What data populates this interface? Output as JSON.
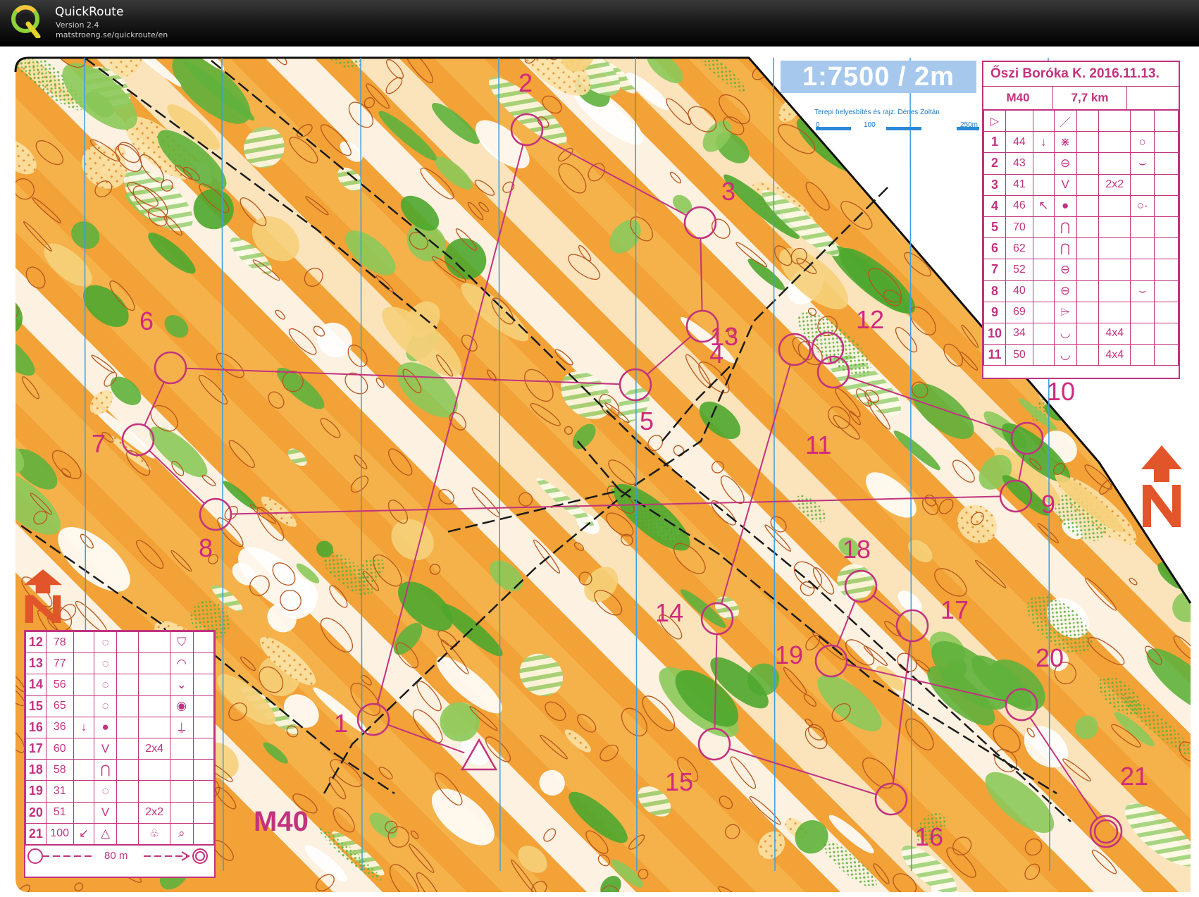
{
  "app": {
    "name": "QuickRoute",
    "version": "Version 2.4",
    "url": "matstroeng.se/quickroute/en"
  },
  "map": {
    "scale": "1:7500  /  2m",
    "credit": "Terepi helyesbítés és rajz: Dénes Zoltán",
    "scale_ticks": [
      "0",
      "100",
      "250m"
    ],
    "course_label": "M40",
    "colors": {
      "course": "#c2337f",
      "open": "#f0a033",
      "forest": "#5fb13c",
      "water": "#3a9ee0"
    }
  },
  "description_top": {
    "event": "Őszi Boróka K. 2016.11.13.",
    "course": "M40",
    "length": "7,7 km",
    "start_symbols": [
      "start-triangle-icon",
      "line-feature-icon"
    ],
    "rows": [
      {
        "n": "1",
        "code": "44",
        "c": "↓",
        "feat": "thicket-icon",
        "dim": "",
        "loc": "○"
      },
      {
        "n": "2",
        "code": "43",
        "c": "",
        "feat": "knoll-icon",
        "dim": "",
        "loc": "⌣"
      },
      {
        "n": "3",
        "code": "41",
        "c": "",
        "feat": "depression-icon",
        "dim": "2x2",
        "loc": ""
      },
      {
        "n": "4",
        "code": "46",
        "c": "↖",
        "feat": "boulder-icon",
        "dim": "",
        "loc": "○·"
      },
      {
        "n": "5",
        "code": "70",
        "c": "",
        "feat": "spur-icon",
        "dim": "",
        "loc": ""
      },
      {
        "n": "6",
        "code": "62",
        "c": "",
        "feat": "spur-icon",
        "dim": "",
        "loc": ""
      },
      {
        "n": "7",
        "code": "52",
        "c": "",
        "feat": "knoll-icon",
        "dim": "",
        "loc": ""
      },
      {
        "n": "8",
        "code": "40",
        "c": "",
        "feat": "knoll-icon",
        "dim": "",
        "loc": "⌣"
      },
      {
        "n": "9",
        "code": "69",
        "c": "",
        "feat": "bend-icon",
        "dim": "",
        "loc": ""
      },
      {
        "n": "10",
        "code": "34",
        "c": "",
        "feat": "gully-icon",
        "dim": "4x4",
        "loc": ""
      },
      {
        "n": "11",
        "code": "50",
        "c": "",
        "feat": "gully-icon",
        "dim": "4x4",
        "loc": ""
      }
    ]
  },
  "description_bottom": {
    "rows": [
      {
        "n": "12",
        "code": "78",
        "c": "",
        "feat": "dotted-circle-icon",
        "dim": "",
        "loc": "⛉"
      },
      {
        "n": "13",
        "code": "77",
        "c": "",
        "feat": "dotted-circle-icon",
        "dim": "",
        "loc": "◠"
      },
      {
        "n": "14",
        "code": "56",
        "c": "",
        "feat": "dotted-circle-icon",
        "dim": "",
        "loc": "⌄"
      },
      {
        "n": "15",
        "code": "65",
        "c": "",
        "feat": "dotted-circle-icon",
        "dim": "",
        "loc": "◉"
      },
      {
        "n": "16",
        "code": "36",
        "c": "↓",
        "feat": "boulder-icon",
        "dim": "",
        "loc": "⍊"
      },
      {
        "n": "17",
        "code": "60",
        "c": "",
        "feat": "depression-icon",
        "dim": "2x4",
        "loc": ""
      },
      {
        "n": "18",
        "code": "58",
        "c": "",
        "feat": "spur-icon",
        "dim": "",
        "loc": ""
      },
      {
        "n": "19",
        "code": "31",
        "c": "",
        "feat": "dotted-circle-icon",
        "dim": "",
        "loc": ""
      },
      {
        "n": "20",
        "code": "51",
        "c": "",
        "feat": "depression-icon",
        "dim": "2x2",
        "loc": ""
      },
      {
        "n": "21",
        "code": "100",
        "c": "↙",
        "feat": "triangle-icon",
        "dim": "♧",
        "loc": "⌕"
      }
    ],
    "finish_text": "80 m"
  },
  "controls": [
    {
      "label": "1"
    },
    {
      "label": "2"
    },
    {
      "label": "3"
    },
    {
      "label": "4"
    },
    {
      "label": "5"
    },
    {
      "label": "6"
    },
    {
      "label": "7"
    },
    {
      "label": "8"
    },
    {
      "label": "9"
    },
    {
      "label": "10"
    },
    {
      "label": "11"
    },
    {
      "label": "12"
    },
    {
      "label": "13"
    },
    {
      "label": "14"
    },
    {
      "label": "15"
    },
    {
      "label": "16"
    },
    {
      "label": "17"
    },
    {
      "label": "18"
    },
    {
      "label": "19"
    },
    {
      "label": "20"
    },
    {
      "label": "21"
    }
  ]
}
